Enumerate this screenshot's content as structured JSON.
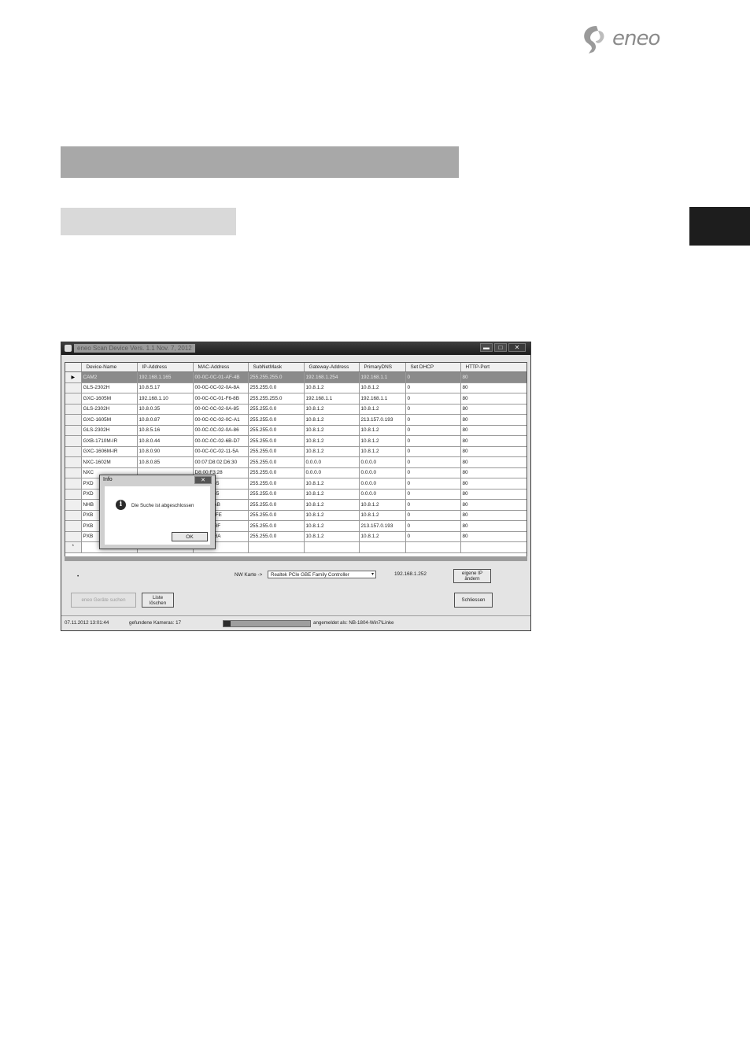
{
  "logo": {
    "text": "eneo"
  },
  "window": {
    "title": "eneo Scan Device   Vers. 1.1 Nov. 7, 2012",
    "controls": [
      "minimize-icon",
      "maximize-icon",
      "close-icon"
    ],
    "grid": {
      "columns": [
        "Device-Name",
        "IP-Address",
        "MAC-Address",
        "SubNetMask",
        "Gateway-Address",
        "PrimaryDNS",
        "Set DHCP",
        "HTTP-Port"
      ],
      "rows": [
        [
          "CAM2",
          "192.168.1.165",
          "00-0C-0C-01-AF-4B",
          "255.255.255.0",
          "192.168.1.254",
          "192.168.1.1",
          "0",
          "80"
        ],
        [
          "GLS-2302H",
          "10.8.5.17",
          "00-0C-0C-02-0A-8A",
          "255.255.0.0",
          "10.8.1.2",
          "10.8.1.2",
          "0",
          "80"
        ],
        [
          "GXC-1605M",
          "192.168.1.10",
          "00-0C-0C-01-F6-8B",
          "255.255.255.0",
          "192.168.1.1",
          "192.168.1.1",
          "0",
          "80"
        ],
        [
          "GLS-2302H",
          "10.8.0.35",
          "00-0C-0C-02-0A-85",
          "255.255.0.0",
          "10.8.1.2",
          "10.8.1.2",
          "0",
          "80"
        ],
        [
          "GXC-1605M",
          "10.8.0.87",
          "00-0C-0C-02-0C-A1",
          "255.255.0.0",
          "10.8.1.2",
          "213.157.0.193",
          "0",
          "80"
        ],
        [
          "GLS-2302H",
          "10.8.5.16",
          "00-0C-0C-02-0A-86",
          "255.255.0.0",
          "10.8.1.2",
          "10.8.1.2",
          "0",
          "80"
        ],
        [
          "GXB-1710M-IR",
          "10.8.0.44",
          "00-0C-0C-02-6B-D7",
          "255.255.0.0",
          "10.8.1.2",
          "10.8.1.2",
          "0",
          "80"
        ],
        [
          "GXC-1606M-IR",
          "10.8.0.90",
          "00-0C-0C-02-11-5A",
          "255.255.0.0",
          "10.8.1.2",
          "10.8.1.2",
          "0",
          "80"
        ],
        [
          "NXC-1602M",
          "10.8.0.85",
          "00:07:D8:02:D6:30",
          "255.255.0.0",
          "0.0.0.0",
          "0.0.0.0",
          "0",
          "80"
        ],
        [
          "NXC",
          "",
          "D8:00:F3:28",
          "255.255.0.0",
          "0.0.0.0",
          "0.0.0.0",
          "0",
          "80"
        ],
        [
          "PXD",
          "",
          "9:0A:37:55",
          "255.255.0.0",
          "10.8.1.2",
          "0.0.0.0",
          "0",
          "80"
        ],
        [
          "PXD",
          "",
          "9:0A:37:55",
          "255.255.0.0",
          "10.8.1.2",
          "0.0.0.0",
          "0",
          "80"
        ],
        [
          "NHB",
          "",
          "9:0A:37:AB",
          "255.255.0.0",
          "10.8.1.2",
          "10.8.1.2",
          "0",
          "80"
        ],
        [
          "PXB",
          "",
          "F-83-AC-FE",
          "255.255.0.0",
          "10.8.1.2",
          "10.8.1.2",
          "0",
          "80"
        ],
        [
          "PXB",
          "",
          "F-83-E3-8F",
          "255.255.0.0",
          "10.8.1.2",
          "213.157.0.193",
          "0",
          "80"
        ],
        [
          "PXB",
          "",
          "F-83-E3-8A",
          "255.255.0.0",
          "10.8.1.2",
          "10.8.1.2",
          "0",
          "80"
        ],
        [
          "",
          "",
          "",
          "",
          "",
          "",
          "",
          ""
        ]
      ],
      "new_row_marker": "*",
      "selected_marker": "▶"
    },
    "dialog": {
      "title": "Info",
      "close": "✕",
      "message": "Die Suche ist abgeschlossen",
      "ok": "OK"
    },
    "controls_area": {
      "dot": "•",
      "nw_label": "NW Karte ->",
      "nw_value": "Realtek PCIe GBE Family Controller",
      "ip": "192.168.1.252",
      "own_ip_btn_1": "eigene IP",
      "own_ip_btn_2": "ändern",
      "search_btn": "eneo Geräte suchen",
      "clear_btn_1": "Liste",
      "clear_btn_2": "löschen",
      "close_btn": "Schliessen"
    },
    "status": {
      "datetime": "07.11.2012 13:01:44",
      "found": "gefundene Kameras: 17",
      "progress": 0.08,
      "logged_in": "angemeldet als:  NB-1804-Win7\\Linke"
    }
  }
}
